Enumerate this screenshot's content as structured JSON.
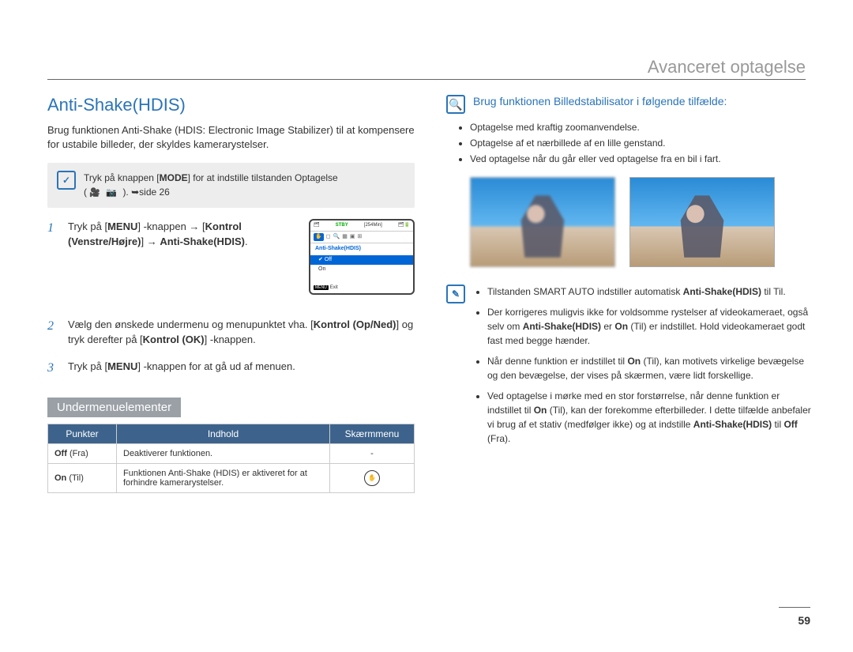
{
  "header": {
    "chapter": "Avanceret optagelse"
  },
  "section_title": "Anti-Shake(HDIS)",
  "intro": "Brug funktionen Anti-Shake (HDIS: Electronic Image Stabilizer) til at kompensere for ustabile billeder, der skyldes kamerarystelser.",
  "note_mode": {
    "prefix": "Tryk på knappen [",
    "mode": "MODE",
    "suffix": "] for at indstille tilstanden Optagelse",
    "icons_line_prefix": "( ",
    "icons_line_suffix": " ). ",
    "page_ref_label": "➥side 26"
  },
  "steps": [
    {
      "parts": [
        "Tryk på [",
        "MENU",
        "] -knappen → [",
        "Kontrol (Venstre/Højre)",
        "] → ",
        "Anti-Shake(HDIS)",
        "."
      ]
    },
    {
      "parts": [
        "Vælg den ønskede undermenu og menupunktet vha. [",
        "Kontrol (Op/Ned)",
        "] og tryk derefter på [",
        "Kontrol (OK)",
        "] -knappen."
      ]
    },
    {
      "parts": [
        "Tryk på [",
        "MENU",
        "] -knappen for at gå ud af menuen."
      ]
    }
  ],
  "screen": {
    "stby": "STBY",
    "time": "[254Min]",
    "title": "Anti-Shake(HDIS)",
    "opt_off": "Off",
    "opt_on": "On",
    "exit": "Exit",
    "menu_badge": "MENU"
  },
  "submenu_header": "Undermenuelementer",
  "table": {
    "headers": [
      "Punkter",
      "Indhold",
      "Skærmmenu"
    ],
    "rows": [
      {
        "label_bold": "Off",
        "label_paren": " (Fra)",
        "content": "Deaktiverer funktionen.",
        "icon": "-"
      },
      {
        "label_bold": "On",
        "label_paren": " (Til)",
        "content": "Funktionen Anti-Shake (HDIS) er aktiveret for at forhindre kamerarystelser.",
        "icon": "hand"
      }
    ]
  },
  "info_header": "Brug funktionen Billedstabilisator i følgende tilfælde:",
  "info_bullets": [
    "Optagelse med kraftig zoomanvendelse.",
    "Optagelse af et nærbillede af en lille genstand.",
    "Ved optagelse når du går eller ved optagelse fra en bil i fart."
  ],
  "note2_bullets": [
    {
      "pre": "Tilstanden SMART AUTO indstiller automatisk ",
      "b1": "Anti-Shake(HDIS)",
      "post": " til Til."
    },
    {
      "pre": "Der korrigeres muligvis ikke for voldsomme rystelser af videokameraet, også selv om ",
      "b1": "Anti-Shake(HDIS)",
      "mid": " er ",
      "b2": "On",
      "post": " (Til) er indstillet. Hold videokameraet godt fast med begge hænder."
    },
    {
      "pre": "Når denne funktion er indstillet til ",
      "b1": "On",
      "post": " (Til), kan motivets virkelige bevægelse og den bevægelse, der vises på skærmen, være lidt forskellige."
    },
    {
      "pre": "Ved optagelse i mørke med en stor forstørrelse, når denne funktion er indstillet til ",
      "b1": "On",
      "mid": " (Til), kan der forekomme efterbilleder. I dette tilfælde anbefaler vi brug af et stativ (medfølger ikke) og at indstille ",
      "b2": "Anti-Shake(HDIS)",
      "mid2": " til ",
      "b3": "Off",
      "post": " (Fra)."
    }
  ],
  "page_number": "59"
}
